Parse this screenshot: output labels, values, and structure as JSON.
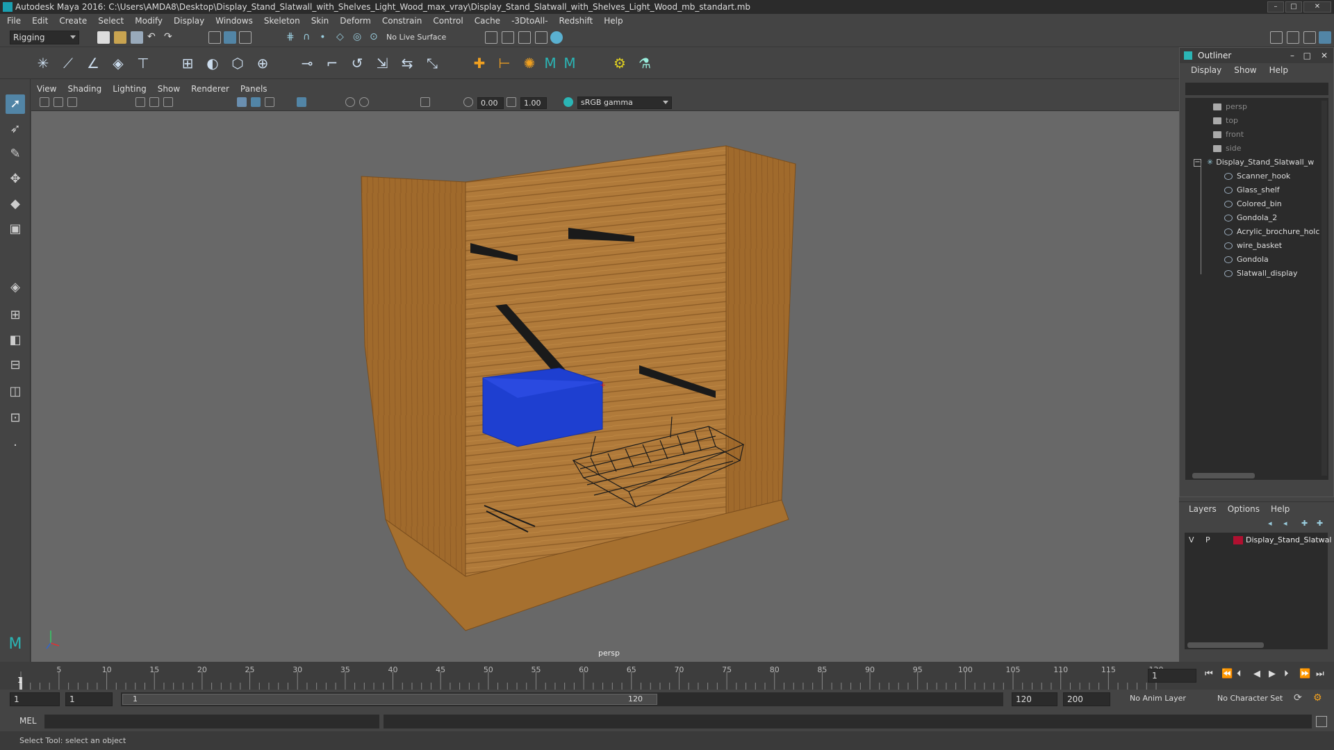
{
  "window": {
    "title": "Autodesk Maya 2016: C:\\Users\\AMDA8\\Desktop\\Display_Stand_Slatwall_with_Shelves_Light_Wood_max_vray\\Display_Stand_Slatwall_with_Shelves_Light_Wood_mb_standart.mb"
  },
  "menubar": {
    "items": [
      "File",
      "Edit",
      "Create",
      "Select",
      "Modify",
      "Display",
      "Windows",
      "Skeleton",
      "Skin",
      "Deform",
      "Constrain",
      "Control",
      "Cache",
      "-3DtoAll-",
      "Redshift",
      "Help"
    ]
  },
  "status_line": {
    "menu_set": "Rigging",
    "live_surface": "No Live Surface"
  },
  "viewport": {
    "menu": [
      "View",
      "Shading",
      "Lighting",
      "Show",
      "Renderer",
      "Panels"
    ],
    "exposure": "0.00",
    "gamma": "1.00",
    "color_space": "sRGB gamma",
    "camera_label": "persp"
  },
  "outliner": {
    "title": "Outliner",
    "menu": [
      "Display",
      "Show",
      "Help"
    ],
    "cameras": [
      "persp",
      "top",
      "front",
      "side"
    ],
    "root": "Display_Stand_Slatwall_w",
    "children": [
      "Scanner_hook",
      "Glass_shelf",
      "Colored_bin",
      "Gondola_2",
      "Acrylic_brochure_holc",
      "wire_basket",
      "Gondola",
      "Slatwall_display"
    ]
  },
  "layers": {
    "menu": [
      "Layers",
      "Options",
      "Help"
    ],
    "layer": {
      "v": "V",
      "p": "P",
      "name": "Display_Stand_Slatwal",
      "color": "#b01030"
    }
  },
  "timeline": {
    "ticks": [
      1,
      5,
      10,
      15,
      20,
      25,
      30,
      35,
      40,
      45,
      50,
      55,
      60,
      65,
      70,
      75,
      80,
      85,
      90,
      95,
      100,
      105,
      110,
      115,
      120
    ],
    "current_frame": "1",
    "current_field": "1"
  },
  "range": {
    "start": "1",
    "playback_start": "1",
    "slider_start": "1",
    "slider_end": "120",
    "playback_end": "120",
    "end": "200",
    "anim_layer": "No Anim Layer",
    "character_set": "No Character Set"
  },
  "cmdline": {
    "label": "MEL"
  },
  "helpline": {
    "text": "Select Tool: select an object"
  },
  "colors": {
    "accent": "#5285a6",
    "wood": "#b07a3a",
    "bin": "#1e3fd0"
  }
}
